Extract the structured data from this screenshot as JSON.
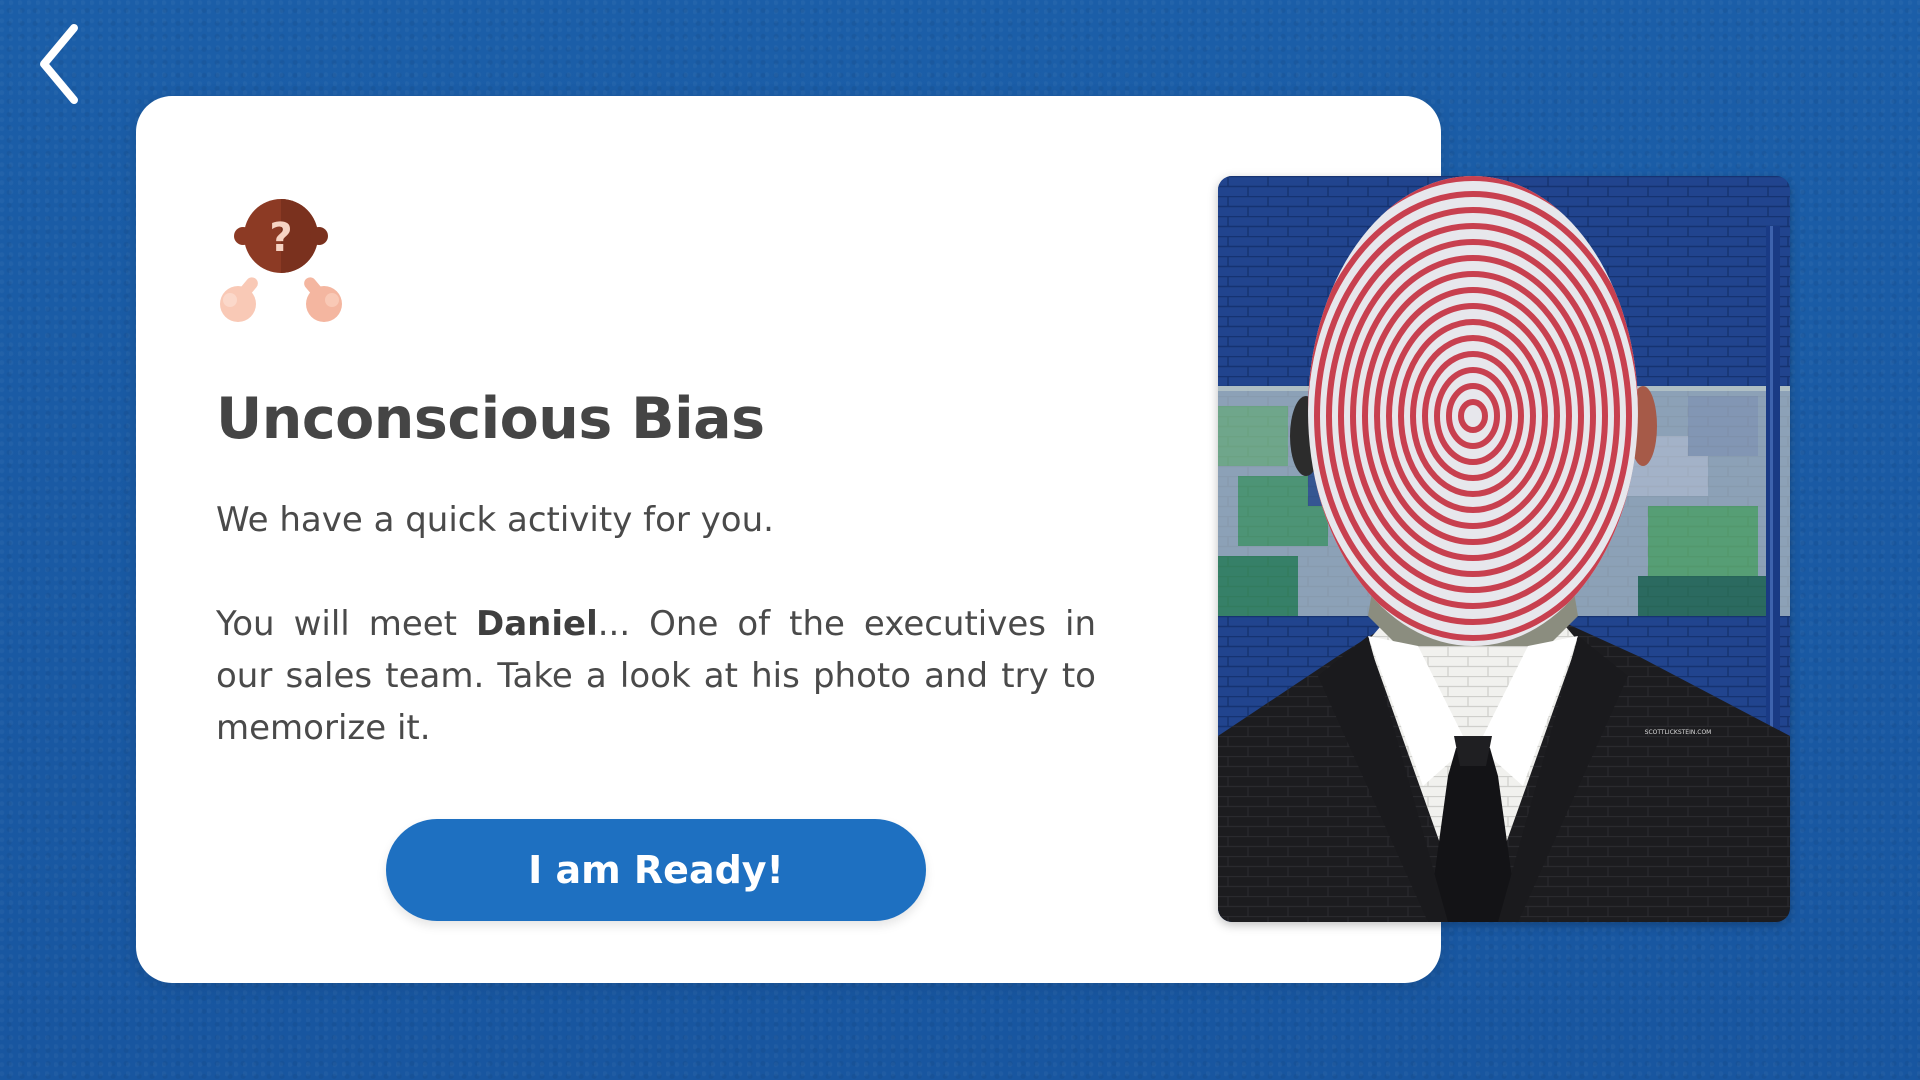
{
  "nav": {
    "back_icon": "chevron-left-icon"
  },
  "card": {
    "icon": "person-question-icon",
    "title": "Unconscious Bias",
    "intro": "We have a quick activity for you.",
    "meet_prefix": "You will meet ",
    "name": "Daniel",
    "meet_suffix": "... One of the executives in our sales team. Take a look at his photo and try to memorize it.",
    "ready_button_label": "I am Ready!"
  },
  "photo": {
    "description_icon": "mural-photo",
    "watermark": "SCOTTLICKSTEIN.COM"
  },
  "colors": {
    "background": "#1a5aa2",
    "card": "#ffffff",
    "title": "#454545",
    "button": "#1e70c1",
    "button_text": "#ffffff"
  }
}
